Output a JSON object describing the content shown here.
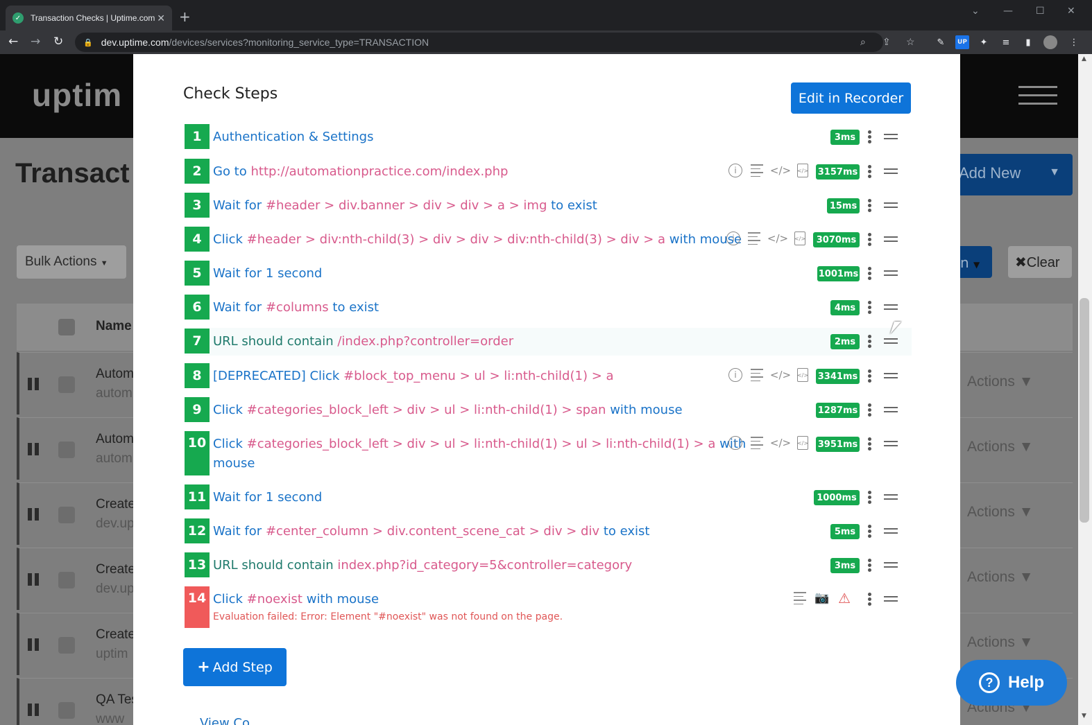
{
  "browser": {
    "tab_title": "Transaction Checks | Uptime.com",
    "url_host": "dev.uptime.com",
    "url_path": "/devices/services?monitoring_service_type=TRANSACTION",
    "ext_label": "UP"
  },
  "background": {
    "logo": "uptim",
    "page_title": "Transact",
    "bulk_actions": "Bulk Actions",
    "add_new": "Add New",
    "filter_frag": "n",
    "clear": "Clear",
    "col_name": "Name",
    "rows": [
      {
        "name": "Autom",
        "sub": "autom",
        "actions": "Actions"
      },
      {
        "name": "Autom",
        "sub": "autom",
        "actions": "Actions"
      },
      {
        "name": "Create",
        "sub": "dev.up",
        "actions": "Actions"
      },
      {
        "name": "Create",
        "sub": "dev.up",
        "actions": "Actions"
      },
      {
        "name": "Create",
        "sub": "uptim",
        "actions": "Actions"
      },
      {
        "name": "QA Tes",
        "sub": "www",
        "actions": "Actions"
      }
    ],
    "help": "Help"
  },
  "modal": {
    "title": "Check Steps",
    "edit_button": "Edit in Recorder",
    "add_step": "Add Step",
    "view_peek": "View Co",
    "steps": [
      {
        "n": "1",
        "time": "3ms",
        "parts": [
          "Authentication & Settings"
        ]
      },
      {
        "n": "2",
        "time": "3157ms",
        "parts": [
          "Go to",
          "http://automationpractice.com/index.php"
        ]
      },
      {
        "n": "3",
        "time": "15ms",
        "parts": [
          "Wait for",
          "#header > div.banner > div > div > a > img",
          "to exist"
        ]
      },
      {
        "n": "4",
        "time": "3070ms",
        "parts": [
          "Click",
          "#header > div:nth-child(3) > div > div > div:nth-child(3) > div > a",
          "with mouse"
        ]
      },
      {
        "n": "5",
        "time": "1001ms",
        "parts": [
          "Wait for 1 second"
        ]
      },
      {
        "n": "6",
        "time": "4ms",
        "parts": [
          "Wait for",
          "#columns",
          "to exist"
        ]
      },
      {
        "n": "7",
        "time": "2ms",
        "parts": [
          "URL should contain",
          "/index.php?controller=order"
        ]
      },
      {
        "n": "8",
        "time": "3341ms",
        "parts": [
          "[DEPRECATED] Click",
          "#block_top_menu > ul > li:nth-child(1) > a"
        ]
      },
      {
        "n": "9",
        "time": "1287ms",
        "parts": [
          "Click",
          "#categories_block_left > div > ul > li:nth-child(1) > span",
          "with mouse"
        ]
      },
      {
        "n": "10",
        "time": "3951ms",
        "parts": [
          "Click",
          "#categories_block_left > div > ul > li:nth-child(1) > ul > li:nth-child(1) > a",
          "with",
          "mouse"
        ]
      },
      {
        "n": "11",
        "time": "1000ms",
        "parts": [
          "Wait for 1 second"
        ]
      },
      {
        "n": "12",
        "time": "5ms",
        "parts": [
          "Wait for",
          "#center_column > div.content_scene_cat > div > div",
          "to exist"
        ]
      },
      {
        "n": "13",
        "time": "3ms",
        "parts": [
          "URL should contain",
          "index.php?id_category=5&controller=category"
        ]
      },
      {
        "n": "14",
        "time": "",
        "parts": [
          "Click",
          "#noexist",
          "with mouse"
        ],
        "error": "Evaluation failed: Error: Element \"#noexist\" was not found on the page."
      }
    ]
  }
}
